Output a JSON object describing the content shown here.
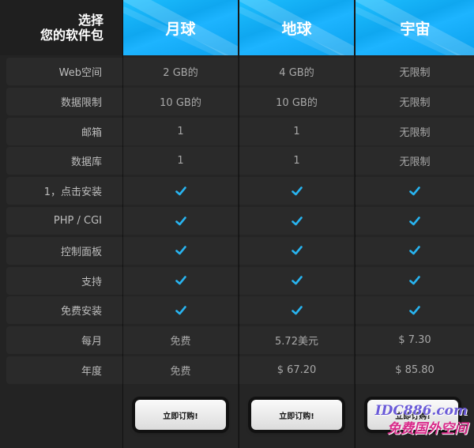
{
  "header": {
    "corner_line1": "选择",
    "corner_line2": "您的软件包",
    "plans": [
      "月球",
      "地球",
      "宇宙"
    ]
  },
  "rows": [
    {
      "label": "Web空间",
      "values": [
        "2 GB的",
        "4 GB的",
        "无限制"
      ]
    },
    {
      "label": "数据限制",
      "values": [
        "10 GB的",
        "10 GB的",
        "无限制"
      ]
    },
    {
      "label": "邮箱",
      "values": [
        "1",
        "1",
        "无限制"
      ]
    },
    {
      "label": "数据库",
      "values": [
        "1",
        "1",
        "无限制"
      ]
    },
    {
      "label": "1，点击安装",
      "values": [
        "check",
        "check",
        "check"
      ]
    },
    {
      "label": "PHP / CGI",
      "values": [
        "check",
        "check",
        "check"
      ]
    },
    {
      "label": "控制面板",
      "values": [
        "check",
        "check",
        "check"
      ]
    },
    {
      "label": "支持",
      "values": [
        "check",
        "check",
        "check"
      ]
    },
    {
      "label": "免费安装",
      "values": [
        "check",
        "check",
        "check"
      ]
    },
    {
      "label": "每月",
      "values": [
        "免费",
        "5.72美元",
        "$ 7.30"
      ]
    },
    {
      "label": "年度",
      "values": [
        "免费",
        "$ 67.20",
        "$ 85.80"
      ]
    }
  ],
  "buttons": {
    "order_label": "立即订购!"
  },
  "watermark": {
    "line1": "IDC886.com",
    "line2": "免费国外空间"
  },
  "colors": {
    "accent": "#1db4ff",
    "check": "#28b4f0"
  }
}
